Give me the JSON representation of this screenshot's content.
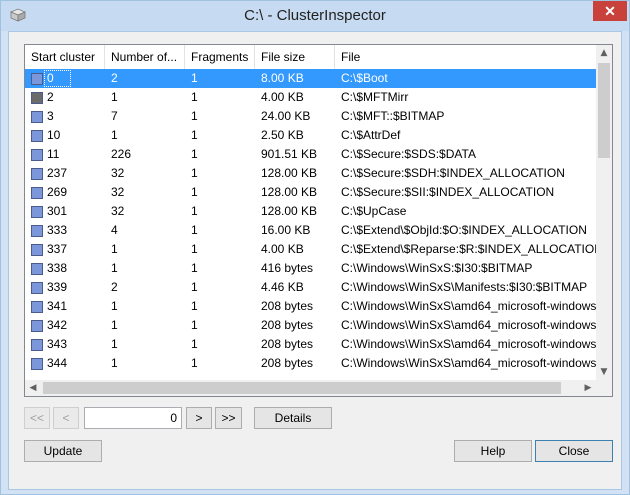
{
  "window": {
    "title": "C:\\ - ClusterInspector",
    "close_glyph": "✕"
  },
  "columns": [
    "Start cluster",
    "Number of...",
    "Fragments",
    "File size",
    "File"
  ],
  "rows": [
    {
      "start": "0",
      "count": "2",
      "fragments": "1",
      "size": "8.00 KB",
      "file": "C:\\$Boot",
      "swatch": "#7c97d9",
      "selected": true
    },
    {
      "start": "2",
      "count": "1",
      "fragments": "1",
      "size": "4.00 KB",
      "file": "C:\\$MFTMirr",
      "swatch": "#6b6b6b"
    },
    {
      "start": "3",
      "count": "7",
      "fragments": "1",
      "size": "24.00 KB",
      "file": "C:\\$MFT::$BITMAP",
      "swatch": "#7c97d9"
    },
    {
      "start": "10",
      "count": "1",
      "fragments": "1",
      "size": "2.50 KB",
      "file": "C:\\$AttrDef",
      "swatch": "#7c97d9"
    },
    {
      "start": "11",
      "count": "226",
      "fragments": "1",
      "size": "901.51 KB",
      "file": "C:\\$Secure:$SDS:$DATA",
      "swatch": "#7c97d9"
    },
    {
      "start": "237",
      "count": "32",
      "fragments": "1",
      "size": "128.00 KB",
      "file": "C:\\$Secure:$SDH:$INDEX_ALLOCATION",
      "swatch": "#7c97d9"
    },
    {
      "start": "269",
      "count": "32",
      "fragments": "1",
      "size": "128.00 KB",
      "file": "C:\\$Secure:$SII:$INDEX_ALLOCATION",
      "swatch": "#7c97d9"
    },
    {
      "start": "301",
      "count": "32",
      "fragments": "1",
      "size": "128.00 KB",
      "file": "C:\\$UpCase",
      "swatch": "#7c97d9"
    },
    {
      "start": "333",
      "count": "4",
      "fragments": "1",
      "size": "16.00 KB",
      "file": "C:\\$Extend\\$ObjId:$O:$INDEX_ALLOCATION",
      "swatch": "#7c97d9"
    },
    {
      "start": "337",
      "count": "1",
      "fragments": "1",
      "size": "4.00 KB",
      "file": "C:\\$Extend\\$Reparse:$R:$INDEX_ALLOCATION",
      "swatch": "#7c97d9"
    },
    {
      "start": "338",
      "count": "1",
      "fragments": "1",
      "size": "416 bytes",
      "file": "C:\\Windows\\WinSxS:$I30:$BITMAP",
      "swatch": "#7c97d9"
    },
    {
      "start": "339",
      "count": "2",
      "fragments": "1",
      "size": "4.46 KB",
      "file": "C:\\Windows\\WinSxS\\Manifests:$I30:$BITMAP",
      "swatch": "#7c97d9"
    },
    {
      "start": "341",
      "count": "1",
      "fragments": "1",
      "size": "208 bytes",
      "file": "C:\\Windows\\WinSxS\\amd64_microsoft-windows",
      "swatch": "#7c97d9"
    },
    {
      "start": "342",
      "count": "1",
      "fragments": "1",
      "size": "208 bytes",
      "file": "C:\\Windows\\WinSxS\\amd64_microsoft-windows",
      "swatch": "#7c97d9"
    },
    {
      "start": "343",
      "count": "1",
      "fragments": "1",
      "size": "208 bytes",
      "file": "C:\\Windows\\WinSxS\\amd64_microsoft-windows",
      "swatch": "#7c97d9"
    },
    {
      "start": "344",
      "count": "1",
      "fragments": "1",
      "size": "208 bytes",
      "file": "C:\\Windows\\WinSxS\\amd64_microsoft-windows",
      "swatch": "#7c97d9"
    }
  ],
  "nav": {
    "first": "<<",
    "prev": "<",
    "page_value": "0",
    "next": ">",
    "last": ">>",
    "details": "Details"
  },
  "footer": {
    "update": "Update",
    "help": "Help",
    "close": "Close"
  },
  "icons": {
    "scroll_up": "▲",
    "scroll_down": "▼",
    "scroll_left": "◀",
    "scroll_right": "▶"
  },
  "colors": {
    "selection": "#3399ff",
    "titlebar": "#c6dbf1",
    "close_button": "#c8413a"
  }
}
